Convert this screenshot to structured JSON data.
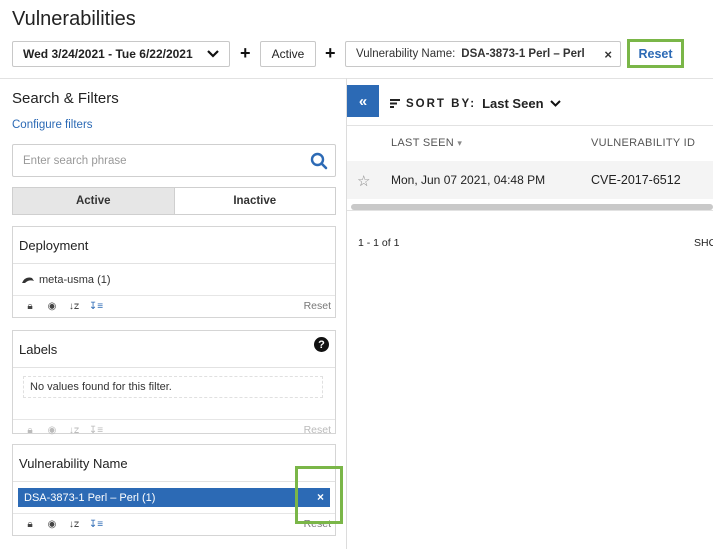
{
  "page": {
    "title": "Vulnerabilities"
  },
  "filterbar": {
    "date_range": "Wed 3/24/2021 - Tue 6/22/2021",
    "plus": "+",
    "active_chip": "Active",
    "vuln_chip_key": "Vulnerability Name:",
    "vuln_chip_value": "DSA-3873-1 Perl – Perl",
    "remove": "×",
    "reset": "Reset"
  },
  "sidebar": {
    "title": "Search & Filters",
    "configure": "Configure filters",
    "search_placeholder": "Enter search phrase",
    "toggle": {
      "active": "Active",
      "inactive": "Inactive"
    },
    "panels": {
      "deployment": {
        "title": "Deployment",
        "item": "meta-usma (1)",
        "reset": "Reset"
      },
      "labels": {
        "title": "Labels",
        "help": "?",
        "empty": "No values found for this filter.",
        "reset": "Reset"
      },
      "vulnerability_name": {
        "title": "Vulnerability Name",
        "selected": "DSA-3873-1 Perl – Perl (1)",
        "remove": "×",
        "reset": "Reset"
      }
    }
  },
  "main": {
    "collapse": "«",
    "sort_label": "SORT BY:",
    "sort_value": "Last Seen",
    "columns": [
      "LAST SEEN",
      "VULNERABILITY ID"
    ],
    "rows": [
      {
        "last_seen": "Mon, Jun 07 2021, 04:48 PM",
        "vulnerability_id": "CVE-2017-6512"
      }
    ],
    "pagination": "1 - 1 of 1",
    "show_truncated": "SHO"
  },
  "colors": {
    "accent": "#2c6ab5",
    "highlight": "#7ab648"
  }
}
